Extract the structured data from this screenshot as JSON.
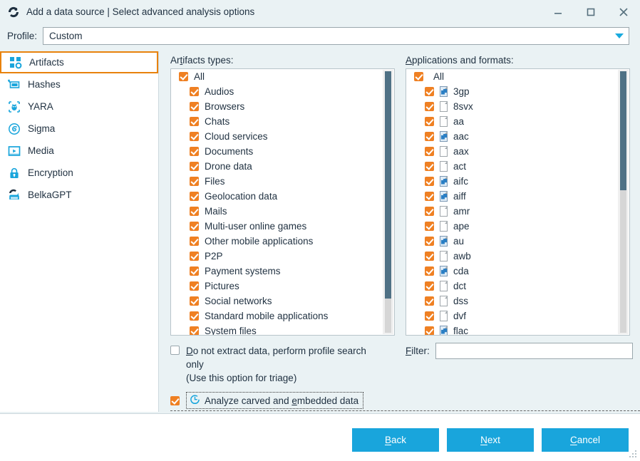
{
  "window": {
    "title": "Add a data source | Select advanced analysis options",
    "app_icon": "belkasoft-logo-icon",
    "controls": [
      {
        "name": "minimize-button",
        "glyph": "minimize-icon"
      },
      {
        "name": "maximize-button",
        "glyph": "maximize-icon"
      },
      {
        "name": "close-button",
        "glyph": "close-icon"
      }
    ]
  },
  "profile": {
    "label": "Profile:",
    "value": "Custom",
    "dropdown_icon": "chevron-down-icon"
  },
  "sidebar": {
    "items": [
      {
        "label": "Artifacts",
        "icon": "artifacts-grid-icon",
        "selected": true
      },
      {
        "label": "Hashes",
        "icon": "hashes-icon",
        "selected": false
      },
      {
        "label": "YARA",
        "icon": "yara-bug-icon",
        "selected": false
      },
      {
        "label": "Sigma",
        "icon": "sigma-spiral-icon",
        "selected": false
      },
      {
        "label": "Media",
        "icon": "media-play-icon",
        "selected": false
      },
      {
        "label": "Encryption",
        "icon": "lock-icon",
        "selected": false
      },
      {
        "label": "BelkaGPT",
        "icon": "belkagpt-icon",
        "selected": false
      }
    ]
  },
  "artifacts_panel": {
    "label": "Artifacts types:",
    "label_accel": "t",
    "root": {
      "label": "All",
      "checked": true
    },
    "items": [
      {
        "label": "Audios",
        "checked": true
      },
      {
        "label": "Browsers",
        "checked": true
      },
      {
        "label": "Chats",
        "checked": true
      },
      {
        "label": "Cloud services",
        "checked": true
      },
      {
        "label": "Documents",
        "checked": true
      },
      {
        "label": "Drone data",
        "checked": true
      },
      {
        "label": "Files",
        "checked": true
      },
      {
        "label": "Geolocation data",
        "checked": true
      },
      {
        "label": "Mails",
        "checked": true
      },
      {
        "label": "Multi-user online games",
        "checked": true
      },
      {
        "label": "Other mobile applications",
        "checked": true
      },
      {
        "label": "P2P",
        "checked": true
      },
      {
        "label": "Payment systems",
        "checked": true
      },
      {
        "label": "Pictures",
        "checked": true
      },
      {
        "label": "Social networks",
        "checked": true
      },
      {
        "label": "Standard mobile applications",
        "checked": true
      },
      {
        "label": "System files",
        "checked": true
      }
    ],
    "scroll_thumb_top_pct": 0,
    "scroll_thumb_height_pct": 86
  },
  "formats_panel": {
    "label": "Applications and formats:",
    "label_accel": "A",
    "root": {
      "label": "All",
      "checked": true
    },
    "items": [
      {
        "label": "3gp",
        "checked": true,
        "file_icon": "media-file-icon"
      },
      {
        "label": "8svx",
        "checked": true,
        "file_icon": "blank-file-icon"
      },
      {
        "label": "aa",
        "checked": true,
        "file_icon": "blank-file-icon"
      },
      {
        "label": "aac",
        "checked": true,
        "file_icon": "media-file-icon"
      },
      {
        "label": "aax",
        "checked": true,
        "file_icon": "blank-file-icon"
      },
      {
        "label": "act",
        "checked": true,
        "file_icon": "blank-file-icon"
      },
      {
        "label": "aifc",
        "checked": true,
        "file_icon": "media-file-icon"
      },
      {
        "label": "aiff",
        "checked": true,
        "file_icon": "media-file-icon"
      },
      {
        "label": "amr",
        "checked": true,
        "file_icon": "blank-file-icon"
      },
      {
        "label": "ape",
        "checked": true,
        "file_icon": "blank-file-icon"
      },
      {
        "label": "au",
        "checked": true,
        "file_icon": "media-file-icon"
      },
      {
        "label": "awb",
        "checked": true,
        "file_icon": "blank-file-icon"
      },
      {
        "label": "cda",
        "checked": true,
        "file_icon": "media-file-icon"
      },
      {
        "label": "dct",
        "checked": true,
        "file_icon": "blank-file-icon"
      },
      {
        "label": "dss",
        "checked": true,
        "file_icon": "blank-file-icon"
      },
      {
        "label": "dvf",
        "checked": true,
        "file_icon": "blank-file-icon"
      },
      {
        "label": "flac",
        "checked": true,
        "file_icon": "media-file-icon"
      }
    ],
    "filter": {
      "label": "Filter:",
      "label_accel": "F",
      "value": "",
      "placeholder": ""
    },
    "scroll_thumb_top_pct": 0,
    "scroll_thumb_height_pct": 45
  },
  "options": {
    "no_extract": {
      "checked": false,
      "line1": "Do not extract data, perform profile search",
      "line2": "only",
      "line3": "(Use this option for triage)"
    },
    "carved": {
      "checked": true,
      "label": "Analyze carved and embedded data",
      "icon": "clock-icon"
    }
  },
  "footer": {
    "buttons": [
      {
        "id": "btn-back",
        "name": "back-button",
        "accel": "B",
        "rest": "ack"
      },
      {
        "id": "btn-next",
        "name": "next-button",
        "accel": "N",
        "rest": "ext"
      },
      {
        "id": "btn-cancel",
        "name": "cancel-button",
        "accel": "C",
        "rest": "ancel"
      }
    ],
    "resize_grip": "resize-grip-icon"
  },
  "colors": {
    "accent_blue": "#19a5dc",
    "check_orange": "#ef8023",
    "selection_orange": "#e8820c",
    "panel_bg": "#eaf2f4",
    "scroll_thumb": "#4f7185"
  }
}
